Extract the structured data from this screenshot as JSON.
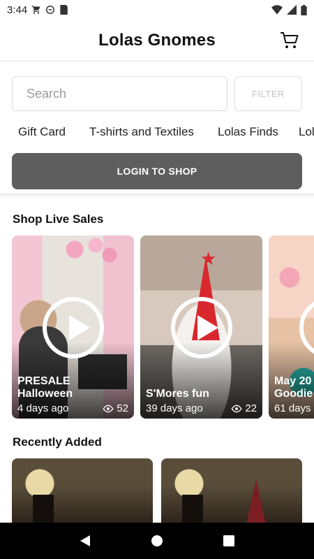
{
  "status_bar": {
    "time": "3:44"
  },
  "header": {
    "title": "Lolas Gnomes"
  },
  "search": {
    "placeholder": "Search",
    "value": "",
    "filter_label": "FILTER"
  },
  "categories": [
    "Gift Card",
    "T-shirts and Textiles",
    "Lolas Finds",
    "Lol"
  ],
  "login": {
    "label": "LOGIN TO SHOP"
  },
  "live_sales": {
    "title": "Shop Live Sales",
    "items": [
      {
        "title": "PRESALE\nHalloween",
        "age": "4 days ago",
        "views": "52"
      },
      {
        "title": "S'Mores fun",
        "age": "39 days ago",
        "views": "22"
      },
      {
        "title": "May 20\nGoodie",
        "age": "61 days",
        "views": ""
      }
    ]
  },
  "recently_added": {
    "title": "Recently Added"
  },
  "colors": {
    "login_bg": "#5e5e5e",
    "nav_bg": "#000000"
  }
}
